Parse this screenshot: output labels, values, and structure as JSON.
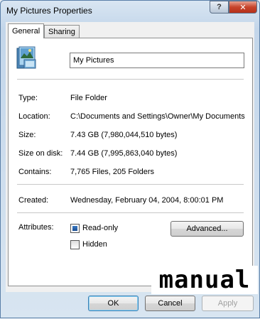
{
  "window": {
    "title": "My Pictures Properties",
    "help_label": "?",
    "close_label": "✕"
  },
  "tabs": [
    {
      "label": "General",
      "active": true
    },
    {
      "label": "Sharing",
      "active": false
    }
  ],
  "general": {
    "icon": "my-pictures-folder-icon",
    "name_value": "My Pictures",
    "type_label": "Type:",
    "type_value": "File Folder",
    "location_label": "Location:",
    "location_value": "C:\\Documents and Settings\\Owner\\My Documents",
    "size_label": "Size:",
    "size_value": "7.43 GB (7,980,044,510 bytes)",
    "size_on_disk_label": "Size on disk:",
    "size_on_disk_value": "7.44 GB (7,995,863,040 bytes)",
    "contains_label": "Contains:",
    "contains_value": "7,765 Files, 205 Folders",
    "created_label": "Created:",
    "created_value": "Wednesday, February 04, 2004, 8:00:01 PM",
    "attributes_label": "Attributes:",
    "readonly_label": "Read-only",
    "readonly_checked": true,
    "hidden_label": "Hidden",
    "hidden_checked": false,
    "advanced_label": "Advanced..."
  },
  "watermark_text": "manual",
  "footer": {
    "ok_label": "OK",
    "cancel_label": "Cancel",
    "apply_label": "Apply"
  }
}
